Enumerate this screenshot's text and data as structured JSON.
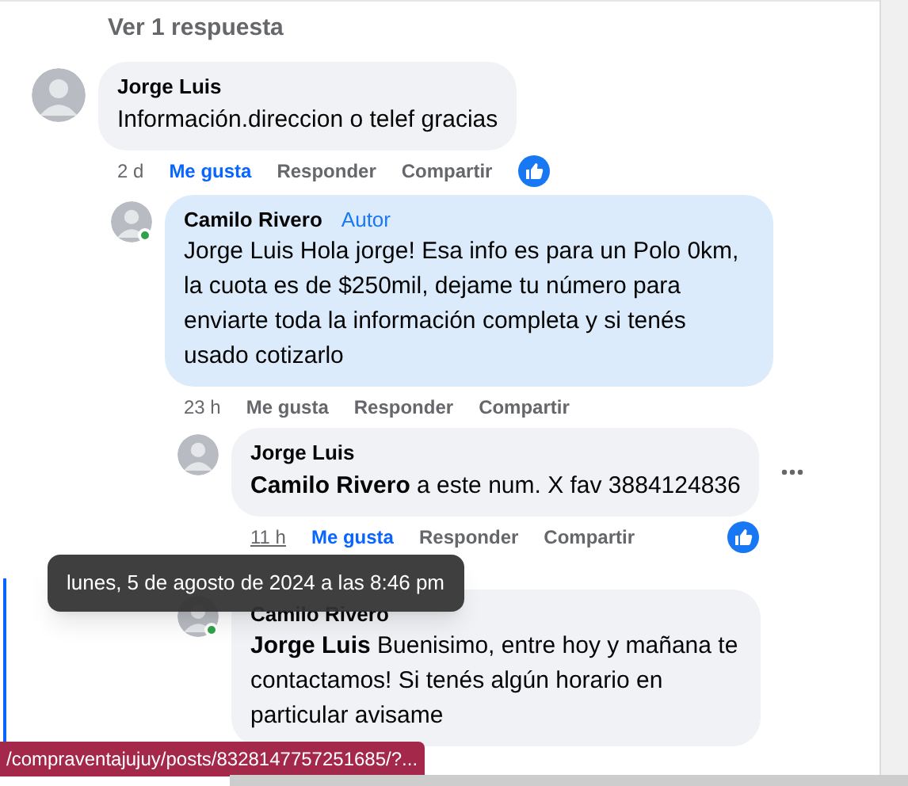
{
  "view_replies": "Ver 1 respuesta",
  "comments": [
    {
      "author": "Jorge Luis",
      "text": "Información.direccion o telef gracias",
      "time": "2 d",
      "time_hovered": false,
      "online": false,
      "highlighted": false,
      "menu_shown": false,
      "reaction_shown": true,
      "actions": [
        {
          "label": "Me gusta",
          "selected": true
        },
        {
          "label": "Responder",
          "selected": false
        },
        {
          "label": "Compartir",
          "selected": false
        }
      ],
      "children": [
        {
          "author": "Camilo Rivero",
          "badge": "Autor",
          "text": "Jorge Luis Hola jorge! Esa info es para un Polo 0km, la cuota es de $250mil, dejame tu número para enviarte toda la información completa y si tenés usado cotizarlo",
          "time": "23 h",
          "time_hovered": false,
          "online": true,
          "highlighted": true,
          "menu_shown": false,
          "reaction_shown": false,
          "actions": [
            {
              "label": "Me gusta",
              "selected": false
            },
            {
              "label": "Responder",
              "selected": false
            },
            {
              "label": "Compartir",
              "selected": false
            }
          ],
          "children": [
            {
              "author": "Jorge Luis",
              "text": "**Camilo Rivero** a este num. X fav 3884124836",
              "time": "11 h",
              "time_hovered": true,
              "online": false,
              "highlighted": false,
              "menu_shown": true,
              "reaction_shown": true,
              "actions": [
                {
                  "label": "Me gusta",
                  "selected": true
                },
                {
                  "label": "Responder",
                  "selected": false
                },
                {
                  "label": "Compartir",
                  "selected": false
                }
              ]
            },
            {
              "author": "Camilo Rivero",
              "text": "**Jorge Luis** Buenisimo, entre hoy y mañana te contactamos! Si tenés algún horario en particular avisame",
              "online": true,
              "highlighted": false,
              "menu_shown": false,
              "reaction_shown": false
            }
          ]
        }
      ]
    }
  ],
  "tooltip": "lunes, 5 de agosto de 2024 a las 8:46 pm",
  "status_url": "/compraventajujuy/posts/8328147757251685/?..."
}
